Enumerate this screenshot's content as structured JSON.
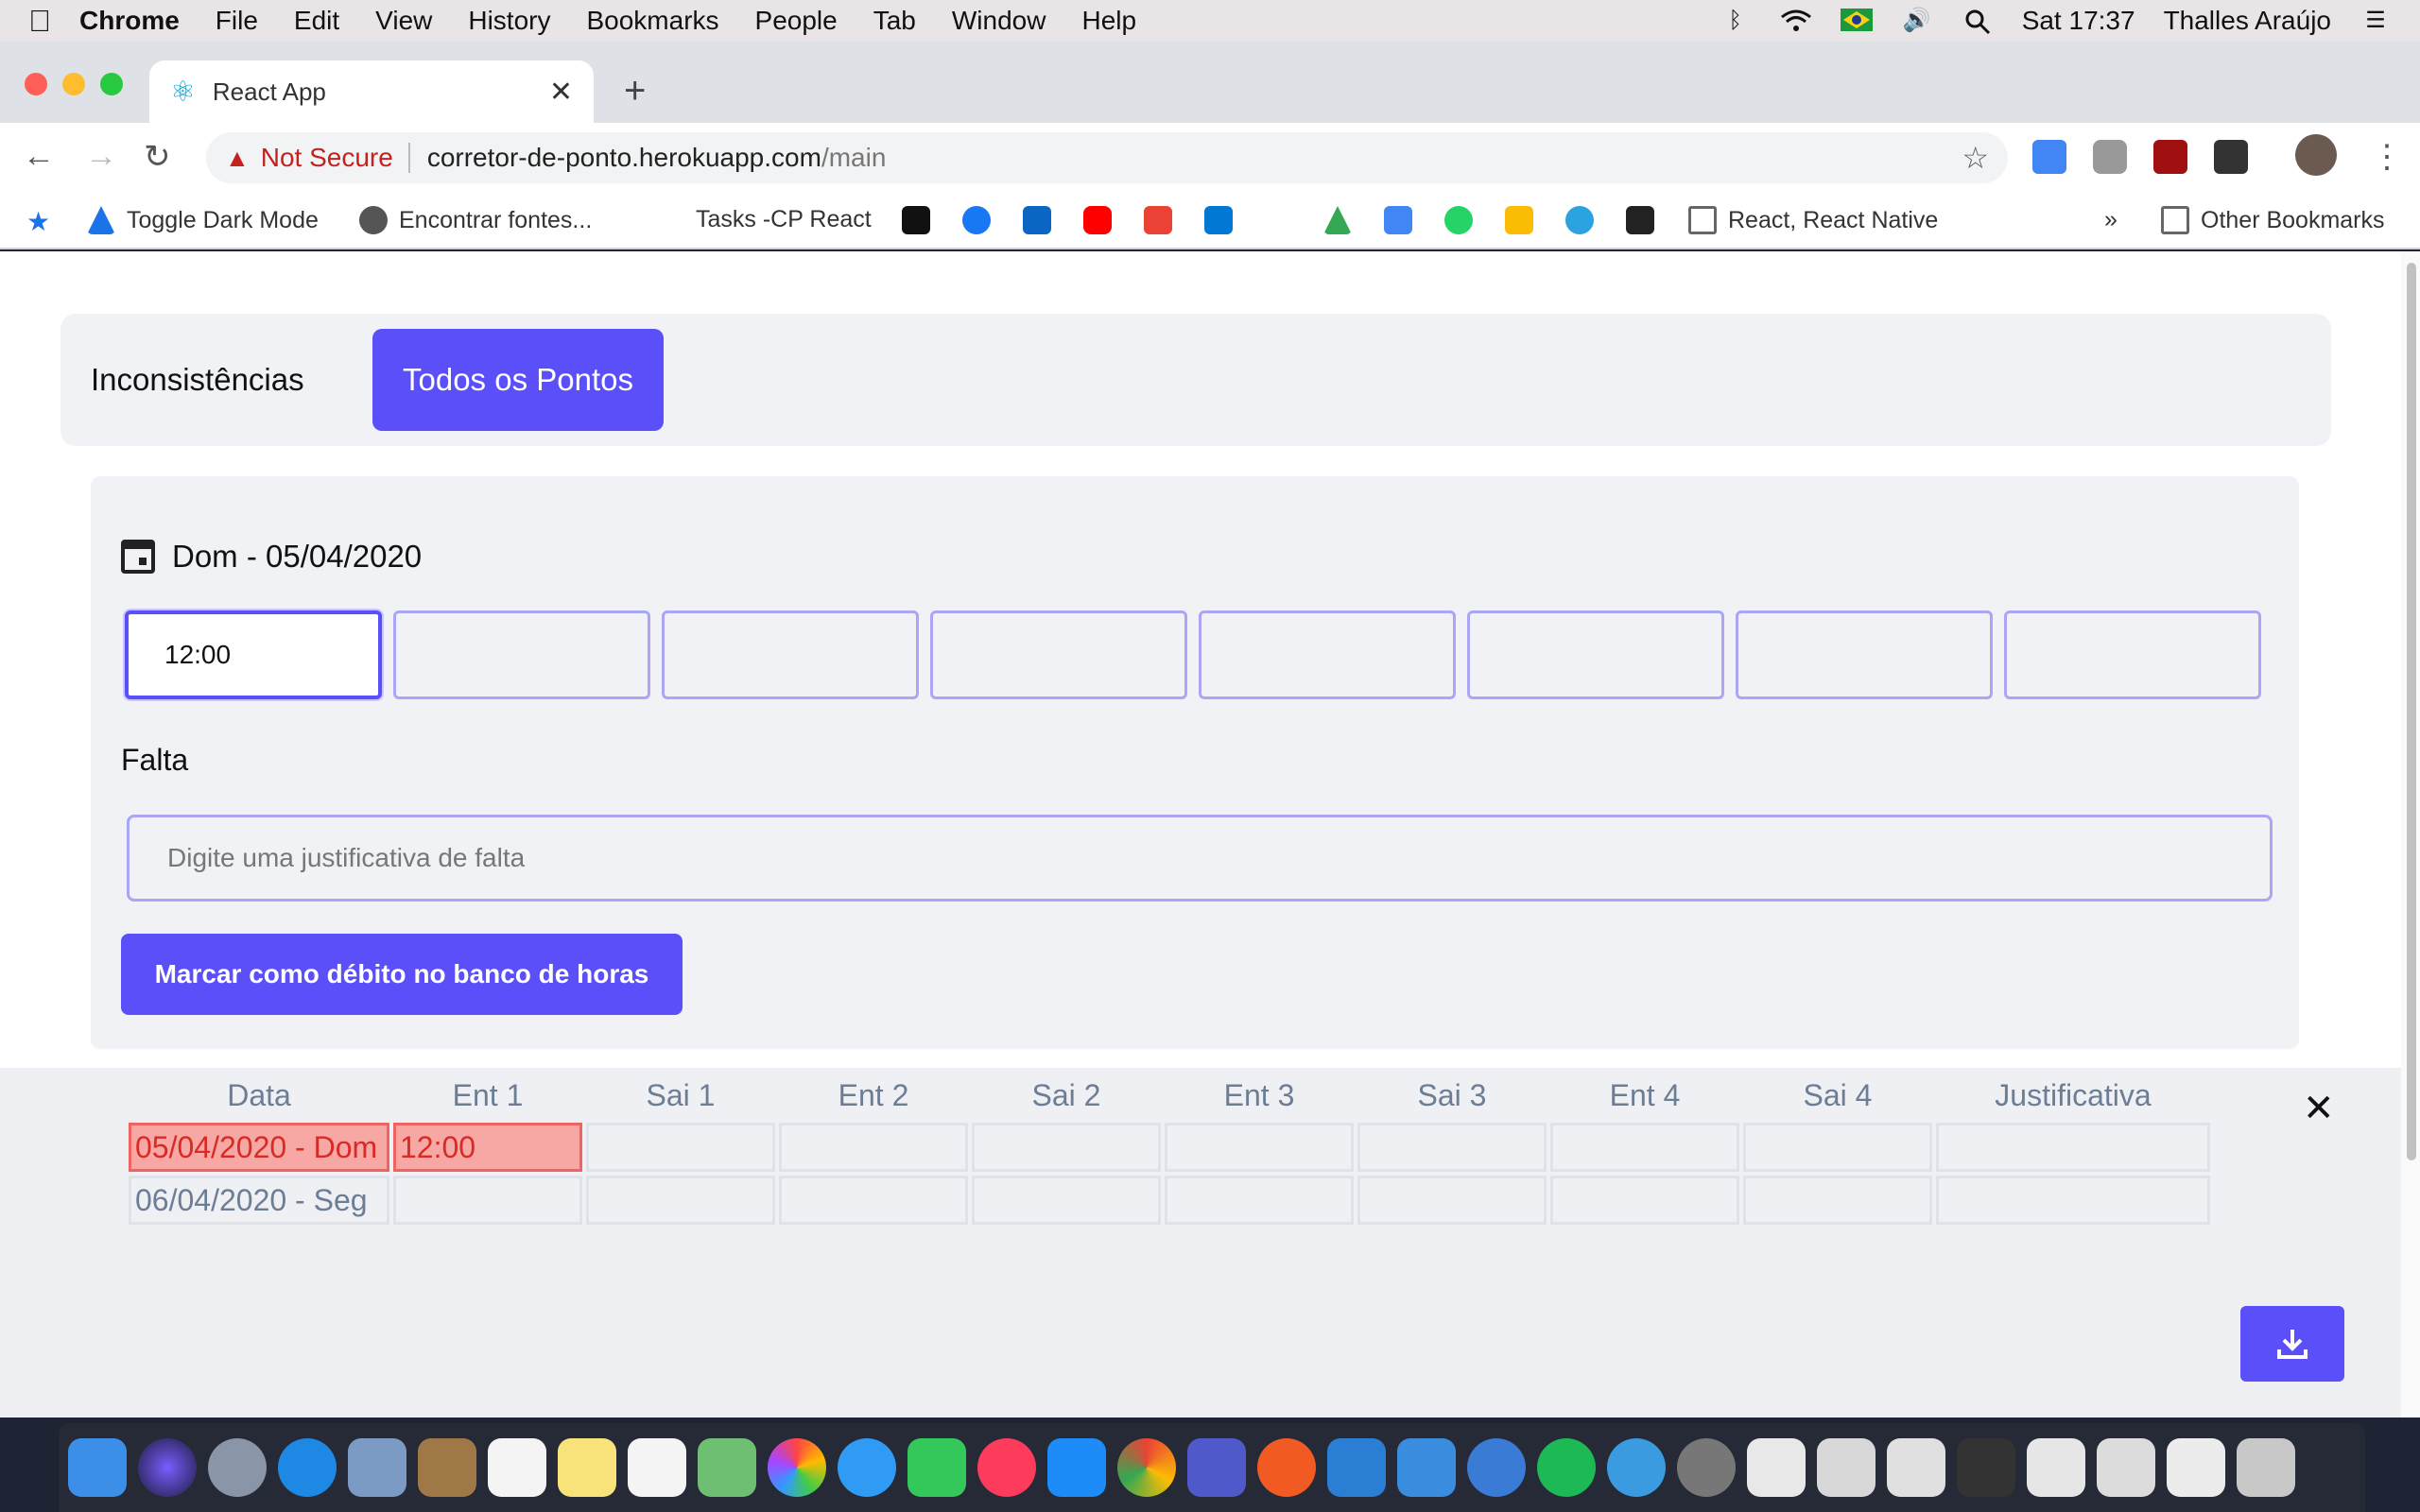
{
  "menubar": {
    "apple": "",
    "app": "Chrome",
    "items": [
      "File",
      "Edit",
      "View",
      "History",
      "Bookmarks",
      "People",
      "Tab",
      "Window",
      "Help"
    ],
    "clock": "Sat 17:37",
    "user": "Thalles Araújo"
  },
  "browser": {
    "tab_title": "React App",
    "new_tab_symbol": "+",
    "close_symbol": "✕",
    "not_secure": "Not Secure",
    "url_host": "corretor-de-ponto.herokuapp.com",
    "url_path": "/main"
  },
  "bookmarks": {
    "items": [
      "Toggle Dark Mode",
      "Encontrar fontes...",
      "Tasks -CP React",
      "React, React Native"
    ],
    "overflow": "»",
    "other": "Other Bookmarks"
  },
  "app": {
    "tabs": [
      "Inconsistências",
      "Todos os Pontos"
    ],
    "active_tab": "Todos os Pontos",
    "date_label": "Dom - 05/04/2020",
    "time_values": [
      "12:00",
      "",
      "",
      "",
      "",
      "",
      "",
      ""
    ],
    "falta_label": "Falta",
    "justificativa_placeholder": "Digite uma justificativa de falta",
    "debit_button": "Marcar como débito no banco de horas",
    "table": {
      "headers": [
        "Data",
        "Ent 1",
        "Sai 1",
        "Ent 2",
        "Sai 2",
        "Ent 3",
        "Sai 3",
        "Ent 4",
        "Sai 4",
        "Justificativa"
      ],
      "rows": [
        [
          "05/04/2020 - Dom",
          "12:00",
          "",
          "",
          "",
          "",
          "",
          "",
          "",
          ""
        ],
        [
          "06/04/2020 - Seg",
          "",
          "",
          "",
          "",
          "",
          "",
          "",
          "",
          ""
        ]
      ]
    },
    "close_symbol": "✕"
  },
  "colors": {
    "primary": "#5a4ff8",
    "error_bg": "#f7a8a4",
    "error_text": "#d92b26"
  }
}
